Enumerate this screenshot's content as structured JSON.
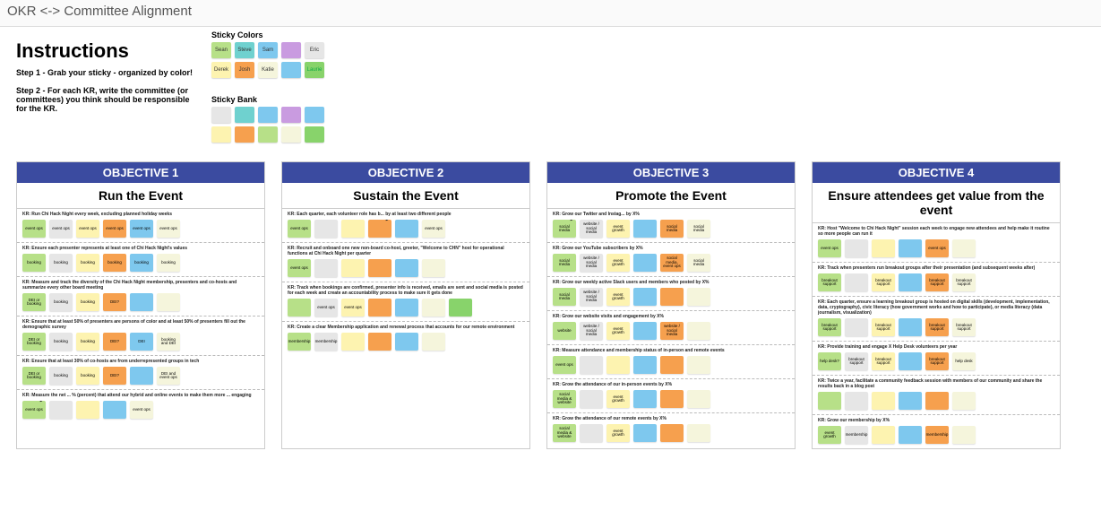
{
  "title": "OKR <-> Committee Alignment",
  "instructions": {
    "heading": "Instructions",
    "step1": "Step 1 - Grab your sticky - organized by color!",
    "step2": "Step 2 - For each KR, write the committee (or committees) you think should be responsible for the KR."
  },
  "sticky_colors": {
    "label": "Sticky Colors",
    "row1": [
      {
        "name": "Sean",
        "cls": "c-green2"
      },
      {
        "name": "Steve",
        "cls": "c-teal"
      },
      {
        "name": "Sam",
        "cls": "c-blue"
      },
      {
        "name": "",
        "cls": "c-purple"
      },
      {
        "name": "Eric",
        "cls": "c-gray"
      }
    ],
    "row2": [
      {
        "name": "Derek",
        "cls": "c-yellow"
      },
      {
        "name": "Josh",
        "cls": "c-orange"
      },
      {
        "name": "Katie",
        "cls": "c-pale"
      },
      {
        "name": "",
        "cls": "c-blue"
      },
      {
        "name": "Laurie",
        "cls": "c-green"
      }
    ]
  },
  "sticky_bank": {
    "label": "Sticky Bank",
    "row1": [
      {
        "cls": "c-gray"
      },
      {
        "cls": "c-teal"
      },
      {
        "cls": "c-blue"
      },
      {
        "cls": "c-purple"
      },
      {
        "cls": "c-blue"
      }
    ],
    "row2": [
      {
        "cls": "c-yellow"
      },
      {
        "cls": "c-orange"
      },
      {
        "cls": "c-green2"
      },
      {
        "cls": "c-pale"
      },
      {
        "cls": "c-green"
      }
    ]
  },
  "objectives": [
    {
      "head": "OBJECTIVE 1",
      "sub": "Run the Event",
      "krs": [
        {
          "title": "KR: Run Chi Hack Night every week, excluding planned holiday weeks",
          "stickies": [
            {
              "t": "event ops",
              "cls": "c-green2"
            },
            {
              "t": "event ops",
              "cls": "c-gray"
            },
            {
              "t": "event ops",
              "cls": "c-yellow"
            },
            {
              "t": "event ops",
              "cls": "c-orange"
            },
            {
              "t": "event ops",
              "cls": "c-blue"
            },
            {
              "t": "event ops",
              "cls": "c-pale"
            }
          ]
        },
        {
          "title": "KR: Ensure each presenter represents at least one of Chi Hack Night's values",
          "stickies": [
            {
              "t": "booking",
              "cls": "c-green2"
            },
            {
              "t": "booking",
              "cls": "c-gray"
            },
            {
              "t": "booking",
              "cls": "c-yellow"
            },
            {
              "t": "booking",
              "cls": "c-orange"
            },
            {
              "t": "booking",
              "cls": "c-blue"
            },
            {
              "t": "booking",
              "cls": "c-pale"
            }
          ]
        },
        {
          "title": "KR: Measure and track the diversity of the Chi Hack Night membership, presenters and co-hosts and summarize every other board meeting",
          "stickies": [
            {
              "t": "DEI or booking",
              "cls": "c-green2"
            },
            {
              "t": "booking",
              "cls": "c-gray"
            },
            {
              "t": "booking",
              "cls": "c-yellow"
            },
            {
              "t": "DEI?",
              "cls": "c-orange"
            },
            {
              "t": "",
              "cls": "c-blue"
            },
            {
              "t": "",
              "cls": "c-pale"
            }
          ]
        },
        {
          "title": "KR: Ensure that at least 50% of presenters are persons of color and at least 50% of presenters fill out the demographic survey",
          "stickies": [
            {
              "t": "DEI or booking",
              "cls": "c-green2"
            },
            {
              "t": "booking",
              "cls": "c-gray"
            },
            {
              "t": "booking",
              "cls": "c-yellow"
            },
            {
              "t": "DEI?",
              "cls": "c-orange"
            },
            {
              "t": "DEI",
              "cls": "c-blue"
            },
            {
              "t": "booking and DEI",
              "cls": "c-pale"
            }
          ]
        },
        {
          "title": "KR: Ensure that at least 30% of co-hosts are from underrepresented groups in tech",
          "stickies": [
            {
              "t": "DEI or booking",
              "cls": "c-green2"
            },
            {
              "t": "booking",
              "cls": "c-gray"
            },
            {
              "t": "booking",
              "cls": "c-yellow"
            },
            {
              "t": "DEI?",
              "cls": "c-orange"
            },
            {
              "t": "",
              "cls": "c-blue"
            },
            {
              "t": "DEI and event ops",
              "cls": "c-pale"
            }
          ]
        },
        {
          "title": "KR: Measure the net ... % (percent) that attend our hybrid and online events to make them more ... engaging",
          "stickies": [
            {
              "t": "event ops",
              "cls": "c-green2",
              "badge": true
            },
            {
              "t": "",
              "cls": "c-gray"
            },
            {
              "t": "",
              "cls": "c-yellow"
            },
            {
              "t": "",
              "cls": "c-blue"
            },
            {
              "t": "event ops",
              "cls": "c-pale"
            }
          ]
        }
      ]
    },
    {
      "head": "OBJECTIVE 2",
      "sub": "Sustain the Event",
      "krs": [
        {
          "title": "KR: Each quarter, each volunteer role has b... by at least two different people",
          "stickies": [
            {
              "t": "event ops",
              "cls": "c-green2"
            },
            {
              "t": "",
              "cls": "c-gray"
            },
            {
              "t": "",
              "cls": "c-yellow"
            },
            {
              "t": "",
              "cls": "c-orange",
              "badge": true
            },
            {
              "t": "",
              "cls": "c-blue"
            },
            {
              "t": "event ops",
              "cls": "c-pale"
            }
          ]
        },
        {
          "title": "KR: Recruit and onboard one new non-board co-host, greeter, \"Welcome to CHN\" host for operational functions at Chi Hack Night per quarter",
          "stickies": [
            {
              "t": "event ops",
              "cls": "c-green2"
            },
            {
              "t": "",
              "cls": "c-gray"
            },
            {
              "t": "",
              "cls": "c-yellow"
            },
            {
              "t": "",
              "cls": "c-orange"
            },
            {
              "t": "",
              "cls": "c-blue"
            },
            {
              "t": "",
              "cls": "c-pale"
            }
          ]
        },
        {
          "title": "KR: Track when bookings are confirmed, presenter info is received, emails are sent and social media is posted for each week and create an accountability process to make sure it gets done",
          "stickies": [
            {
              "t": "",
              "cls": "c-green2"
            },
            {
              "t": "event ops",
              "cls": "c-gray"
            },
            {
              "t": "event ops",
              "cls": "c-yellow"
            },
            {
              "t": "",
              "cls": "c-orange"
            },
            {
              "t": "",
              "cls": "c-blue"
            },
            {
              "t": "",
              "cls": "c-pale"
            },
            {
              "t": "",
              "cls": "c-green"
            }
          ]
        },
        {
          "title": "KR: Create a clear Membership application and renewal process that accounts for our remote environment",
          "stickies": [
            {
              "t": "membership",
              "cls": "c-green2"
            },
            {
              "t": "membership",
              "cls": "c-gray"
            },
            {
              "t": "",
              "cls": "c-yellow"
            },
            {
              "t": "",
              "cls": "c-orange"
            },
            {
              "t": "",
              "cls": "c-blue"
            },
            {
              "t": "",
              "cls": "c-pale"
            }
          ]
        }
      ]
    },
    {
      "head": "OBJECTIVE 3",
      "sub": "Promote the Event",
      "krs": [
        {
          "title": "KR: Grow our Twitter and Instag... by X%",
          "stickies": [
            {
              "t": "social media",
              "cls": "c-green2",
              "badge": true
            },
            {
              "t": "website / social media",
              "cls": "c-gray"
            },
            {
              "t": "event growth",
              "cls": "c-yellow"
            },
            {
              "t": "",
              "cls": "c-blue"
            },
            {
              "t": "social media",
              "cls": "c-orange"
            },
            {
              "t": "social media",
              "cls": "c-pale"
            }
          ]
        },
        {
          "title": "KR: Grow our YouTube subscribers by X%",
          "stickies": [
            {
              "t": "social media",
              "cls": "c-green2"
            },
            {
              "t": "website / social media",
              "cls": "c-gray"
            },
            {
              "t": "event growth",
              "cls": "c-yellow"
            },
            {
              "t": "",
              "cls": "c-blue"
            },
            {
              "t": "social media, event ops",
              "cls": "c-orange"
            },
            {
              "t": "social media",
              "cls": "c-pale"
            }
          ]
        },
        {
          "title": "KR: Grow our weekly active Slack users and members who posted by X%",
          "stickies": [
            {
              "t": "social media",
              "cls": "c-green2"
            },
            {
              "t": "website / social media",
              "cls": "c-gray"
            },
            {
              "t": "event growth",
              "cls": "c-yellow"
            },
            {
              "t": "",
              "cls": "c-blue"
            },
            {
              "t": "",
              "cls": "c-orange"
            },
            {
              "t": "",
              "cls": "c-pale"
            }
          ]
        },
        {
          "title": "KR: Grow our website visits and engagement by X%",
          "stickies": [
            {
              "t": "website",
              "cls": "c-green2"
            },
            {
              "t": "website / social media",
              "cls": "c-gray"
            },
            {
              "t": "event growth",
              "cls": "c-yellow"
            },
            {
              "t": "",
              "cls": "c-blue"
            },
            {
              "t": "website / social media",
              "cls": "c-orange"
            },
            {
              "t": "",
              "cls": "c-pale"
            }
          ]
        },
        {
          "title": "KR: Measure attendance and membership status of in-person and remote events",
          "stickies": [
            {
              "t": "event ops",
              "cls": "c-green2"
            },
            {
              "t": "",
              "cls": "c-gray"
            },
            {
              "t": "",
              "cls": "c-yellow"
            },
            {
              "t": "",
              "cls": "c-blue"
            },
            {
              "t": "",
              "cls": "c-orange"
            },
            {
              "t": "",
              "cls": "c-pale"
            }
          ]
        },
        {
          "title": "KR: Grow the attendance of our in-person events by X%",
          "stickies": [
            {
              "t": "social media & website",
              "cls": "c-green2"
            },
            {
              "t": "",
              "cls": "c-gray"
            },
            {
              "t": "event growth",
              "cls": "c-yellow"
            },
            {
              "t": "",
              "cls": "c-blue"
            },
            {
              "t": "",
              "cls": "c-orange"
            },
            {
              "t": "",
              "cls": "c-pale"
            }
          ]
        },
        {
          "title": "KR: Grow the attendance of our remote events by X%",
          "stickies": [
            {
              "t": "social media & website",
              "cls": "c-green2"
            },
            {
              "t": "",
              "cls": "c-gray"
            },
            {
              "t": "event growth",
              "cls": "c-yellow"
            },
            {
              "t": "",
              "cls": "c-blue"
            },
            {
              "t": "",
              "cls": "c-orange"
            },
            {
              "t": "",
              "cls": "c-pale"
            }
          ]
        }
      ]
    },
    {
      "head": "OBJECTIVE 4",
      "sub": "Ensure attendees get value from the event",
      "krs": [
        {
          "title": "KR: Host \"Welcome to Chi Hack Night\" session each week to engage new attendees and help make it routine so more people can run it",
          "stickies": [
            {
              "t": "event ops",
              "cls": "c-green2"
            },
            {
              "t": "",
              "cls": "c-gray"
            },
            {
              "t": "",
              "cls": "c-yellow"
            },
            {
              "t": "",
              "cls": "c-blue"
            },
            {
              "t": "event ops",
              "cls": "c-orange"
            },
            {
              "t": "",
              "cls": "c-pale"
            }
          ]
        },
        {
          "title": "KR: Track when presenters run breakout groups after their presentation (and subsequent weeks after)",
          "stickies": [
            {
              "t": "breakout support",
              "cls": "c-green2"
            },
            {
              "t": "",
              "cls": "c-gray"
            },
            {
              "t": "breakout support",
              "cls": "c-yellow"
            },
            {
              "t": "",
              "cls": "c-blue"
            },
            {
              "t": "breakout support",
              "cls": "c-orange"
            },
            {
              "t": "breakout support",
              "cls": "c-pale"
            }
          ]
        },
        {
          "title": "KR: Each quarter, ensure a learning breakout group is hosted on digital skills (development, implementation, data, cryptography), civic literacy (how government works and how to participate), or media literacy (data journalism, visualization)",
          "stickies": [
            {
              "t": "breakout support",
              "cls": "c-green2"
            },
            {
              "t": "",
              "cls": "c-gray"
            },
            {
              "t": "breakout support",
              "cls": "c-yellow"
            },
            {
              "t": "",
              "cls": "c-blue"
            },
            {
              "t": "breakout support",
              "cls": "c-orange"
            },
            {
              "t": "breakout support",
              "cls": "c-pale"
            }
          ]
        },
        {
          "title": "KR: Provide training and engage X Help Desk volunteers per year",
          "stickies": [
            {
              "t": "help desk?",
              "cls": "c-green2"
            },
            {
              "t": "breakout support",
              "cls": "c-gray"
            },
            {
              "t": "breakout support",
              "cls": "c-yellow"
            },
            {
              "t": "",
              "cls": "c-blue"
            },
            {
              "t": "breakout support",
              "cls": "c-orange"
            },
            {
              "t": "help desk",
              "cls": "c-pale"
            }
          ]
        },
        {
          "title": "KR: Twice a year, facilitate a community feedback session with members of our community and share the results back in a blog post",
          "stickies": [
            {
              "t": "",
              "cls": "c-green2"
            },
            {
              "t": "",
              "cls": "c-gray"
            },
            {
              "t": "",
              "cls": "c-yellow"
            },
            {
              "t": "",
              "cls": "c-blue"
            },
            {
              "t": "",
              "cls": "c-orange"
            },
            {
              "t": "",
              "cls": "c-pale"
            }
          ]
        },
        {
          "title": "KR: Grow our membership by X%",
          "stickies": [
            {
              "t": "event growth",
              "cls": "c-green2"
            },
            {
              "t": "membership",
              "cls": "c-gray"
            },
            {
              "t": "",
              "cls": "c-yellow"
            },
            {
              "t": "",
              "cls": "c-blue"
            },
            {
              "t": "membership",
              "cls": "c-orange"
            },
            {
              "t": "",
              "cls": "c-pale"
            }
          ]
        }
      ]
    }
  ]
}
